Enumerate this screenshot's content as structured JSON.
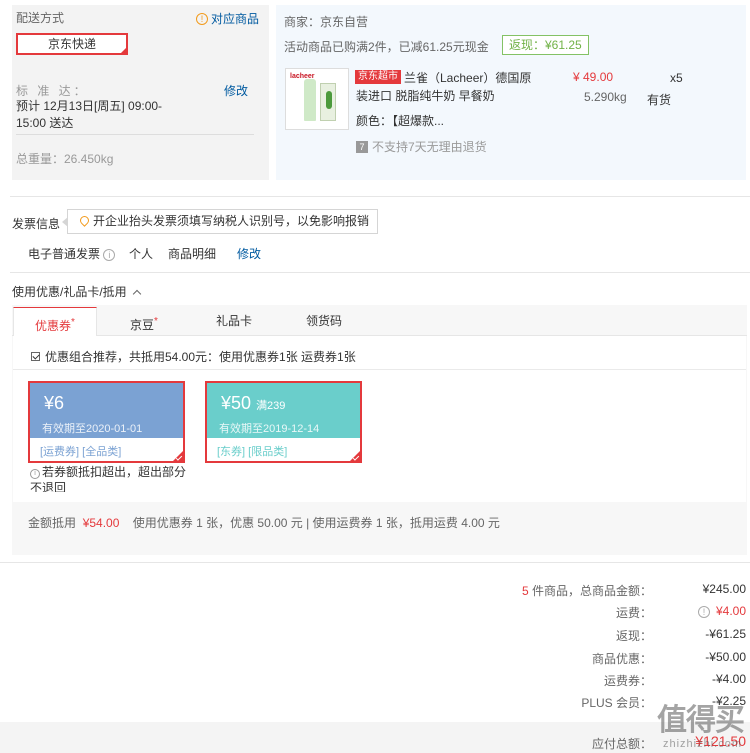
{
  "shipping": {
    "title": "配送方式",
    "match_link": "对应商品",
    "method": "京东快递",
    "standard_label": "标 准 达：",
    "edit": "修改",
    "eta": "预计 12月13日[周五] 09:00-15:00 送达",
    "total_weight": "总重量：26.450kg"
  },
  "seller": {
    "name": "商家：京东自营",
    "promo": "活动商品已购满2件，已减61.25元现金",
    "cashback": "返现：¥61.25"
  },
  "product": {
    "jd_tag": "京东超市",
    "title": "兰雀（Lacheer）德国原装进口 脱脂纯牛奶 早餐奶",
    "color": "颜色：【超爆款...",
    "no_return": "不支持7天无理由退货",
    "price": "¥ 49.00",
    "qty": "x5",
    "weight": "5.290kg",
    "stock": "有货",
    "image_logo": "lacheer"
  },
  "invoice": {
    "label": "发票信息",
    "tip": "开企业抬头发票须填写纳税人识别号，以免影响报销",
    "type": "电子普通发票",
    "title_type": "个人",
    "content": "商品明细",
    "edit": "修改"
  },
  "coupons": {
    "section_title": "使用优惠/礼品卡/抵用",
    "tabs": [
      "优惠券",
      "京豆",
      "礼品卡",
      "领货码"
    ],
    "tab_star": "*",
    "combo_text": "优惠组合推荐，共抵用54.00元：使用优惠券1张 运费券1张",
    "cards": [
      {
        "amount": "¥6",
        "condition": "",
        "valid": "有效期至2020-01-01",
        "tags": "[运费券] [全品类]"
      },
      {
        "amount": "¥50",
        "condition": "满239",
        "valid": "有效期至2019-12-14",
        "tags": "[东券] [限品类]"
      }
    ],
    "overflow_note": "若券额抵扣超出，超出部分不退回",
    "summary_prefix": "金额抵用",
    "summary_amount": "¥54.00",
    "summary_rest": "使用优惠券 1 张，优惠 50.00 元 | 使用运费券 1 张，抵用运费 4.00 元"
  },
  "totals": {
    "item_count": "5",
    "items_label": "件商品，总商品金额：",
    "items_value": "¥245.00",
    "shipping_label": "运费：",
    "shipping_value": "¥4.00",
    "cashback_label": "返现：",
    "cashback_value": "-¥61.25",
    "discount_label": "商品优惠：",
    "discount_value": "-¥50.00",
    "ship_coupon_label": "运费券：",
    "ship_coupon_value": "-¥4.00",
    "plus_label": "PLUS 会员：",
    "plus_value": "-¥2.25",
    "due_label": "应付总额：",
    "due_value": "¥121.50"
  },
  "watermark": {
    "main": "值得买",
    "sub": "zhizhizhi.com"
  },
  "colors": {
    "accent": "#e4393c",
    "link": "#005aa0",
    "cashback": "#71b247",
    "coupon_blue": "#7ba2d3",
    "coupon_teal": "#6acecb"
  }
}
